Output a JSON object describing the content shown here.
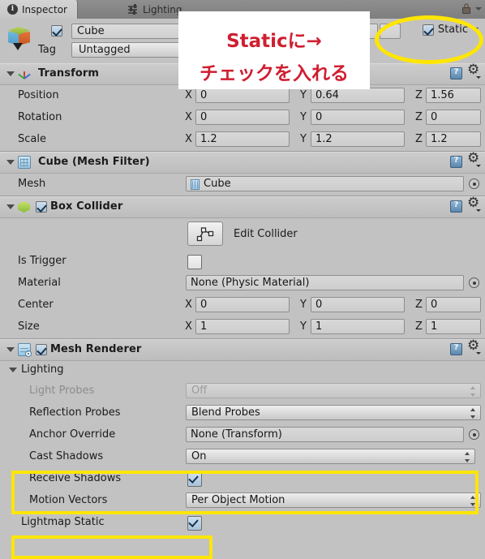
{
  "window": {
    "tabs": [
      {
        "label": "Inspector",
        "icon": "info-icon",
        "active": true
      },
      {
        "label": "Lighting",
        "icon": "sliders-icon",
        "active": false
      }
    ],
    "lock_icon": "lock-icon"
  },
  "object_header": {
    "enabled_checkbox": "checked",
    "name": "Cube",
    "tag_label": "Tag",
    "tag_value": "Untagged",
    "static_label": "Static",
    "static_checkbox": "checked"
  },
  "callout": {
    "line1": "Staticに→",
    "line2": "チェックを入れる",
    "color": "#cf1f30",
    "background": "#ffffff"
  },
  "highlight_color": "#ffe600",
  "components": [
    {
      "name": "Transform",
      "icon": "transform-axis-icon",
      "has_enable_checkbox": false,
      "rows": [
        {
          "label": "Position",
          "type": "vector3",
          "axes": [
            "X",
            "Y",
            "Z"
          ],
          "values": [
            "0",
            "0.64",
            "1.56"
          ]
        },
        {
          "label": "Rotation",
          "type": "vector3",
          "axes": [
            "X",
            "Y",
            "Z"
          ],
          "values": [
            "0",
            "0",
            "0"
          ]
        },
        {
          "label": "Scale",
          "type": "vector3",
          "axes": [
            "X",
            "Y",
            "Z"
          ],
          "values": [
            "1.2",
            "1.2",
            "1.2"
          ]
        }
      ]
    },
    {
      "name": "Cube (Mesh Filter)",
      "icon": "mesh-filter-icon",
      "has_enable_checkbox": false,
      "rows": [
        {
          "label": "Mesh",
          "type": "object",
          "value": "Cube"
        }
      ]
    },
    {
      "name": "Box Collider",
      "icon": "box-collider-icon",
      "has_enable_checkbox": true,
      "enabled": "checked",
      "rows": [
        {
          "label": "",
          "type": "button",
          "value": "Edit Collider"
        },
        {
          "label": "Is Trigger",
          "type": "checkbox",
          "value": "unchecked"
        },
        {
          "label": "Material",
          "type": "object",
          "value": "None (Physic Material)"
        },
        {
          "label": "Center",
          "type": "vector3",
          "axes": [
            "X",
            "Y",
            "Z"
          ],
          "values": [
            "0",
            "0",
            "0"
          ]
        },
        {
          "label": "Size",
          "type": "vector3",
          "axes": [
            "X",
            "Y",
            "Z"
          ],
          "values": [
            "1",
            "1",
            "1"
          ]
        }
      ]
    },
    {
      "name": "Mesh Renderer",
      "icon": "mesh-renderer-icon",
      "has_enable_checkbox": true,
      "enabled": "checked",
      "group": "Lighting",
      "rows": [
        {
          "label": "Light Probes",
          "type": "popup",
          "value": "Off",
          "disabled": true
        },
        {
          "label": "Reflection Probes",
          "type": "popup",
          "value": "Blend Probes",
          "disabled": false
        },
        {
          "label": "Anchor Override",
          "type": "object",
          "value": "None (Transform)"
        },
        {
          "label": "Cast Shadows",
          "type": "popup",
          "value": "On",
          "disabled": false,
          "highlighted": true
        },
        {
          "label": "Receive Shadows",
          "type": "checkbox",
          "value": "checked",
          "highlighted": true
        },
        {
          "label": "Motion Vectors",
          "type": "popup",
          "value": "Per Object Motion",
          "disabled": false
        },
        {
          "label": "Lightmap Static",
          "type": "checkbox",
          "value": "checked",
          "highlighted": true
        }
      ]
    }
  ]
}
